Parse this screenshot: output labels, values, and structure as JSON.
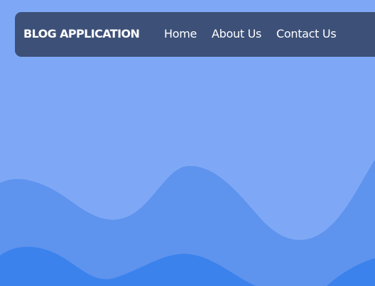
{
  "navbar": {
    "brand": "BLOG APPLICATION",
    "links": [
      {
        "label": "Home"
      },
      {
        "label": "About Us"
      },
      {
        "label": "Contact Us"
      }
    ]
  },
  "colors": {
    "background": "#7ea8f5",
    "navbar": "#3d5078",
    "wave_mid": "#5e93ee",
    "wave_front": "#3b82ec",
    "text": "#ffffff"
  }
}
